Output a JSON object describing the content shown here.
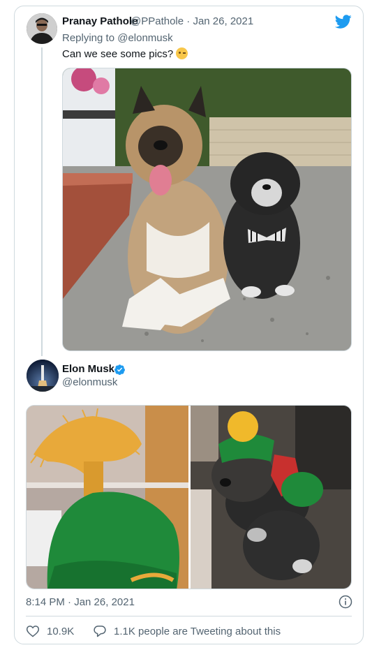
{
  "reply_tweet": {
    "name": "Pranay Pathole",
    "handle": "@PPathole",
    "separator": "·",
    "date": "Jan 26, 2021",
    "replying_to_prefix": "Replying to",
    "replying_to_mention": "@elonmusk",
    "text": "Can we see some pics?",
    "emoji_icon": "winking-face-emoji"
  },
  "main_tweet": {
    "name": "Elon Musk",
    "handle": "@elonmusk",
    "timestamp": "8:14 PM · Jan 26, 2021",
    "likes": "10.9K",
    "conversation": "1.1K people are Tweeting about this"
  },
  "colors": {
    "twitter_blue": "#1d9bf0",
    "text_primary": "#0f1419",
    "text_secondary": "#536471",
    "border": "#cfd9de"
  },
  "icons": {
    "brand": "twitter-bird-icon",
    "verified": "verified-badge-icon",
    "info": "info-icon",
    "like": "heart-icon",
    "reply": "speech-bubble-icon"
  }
}
